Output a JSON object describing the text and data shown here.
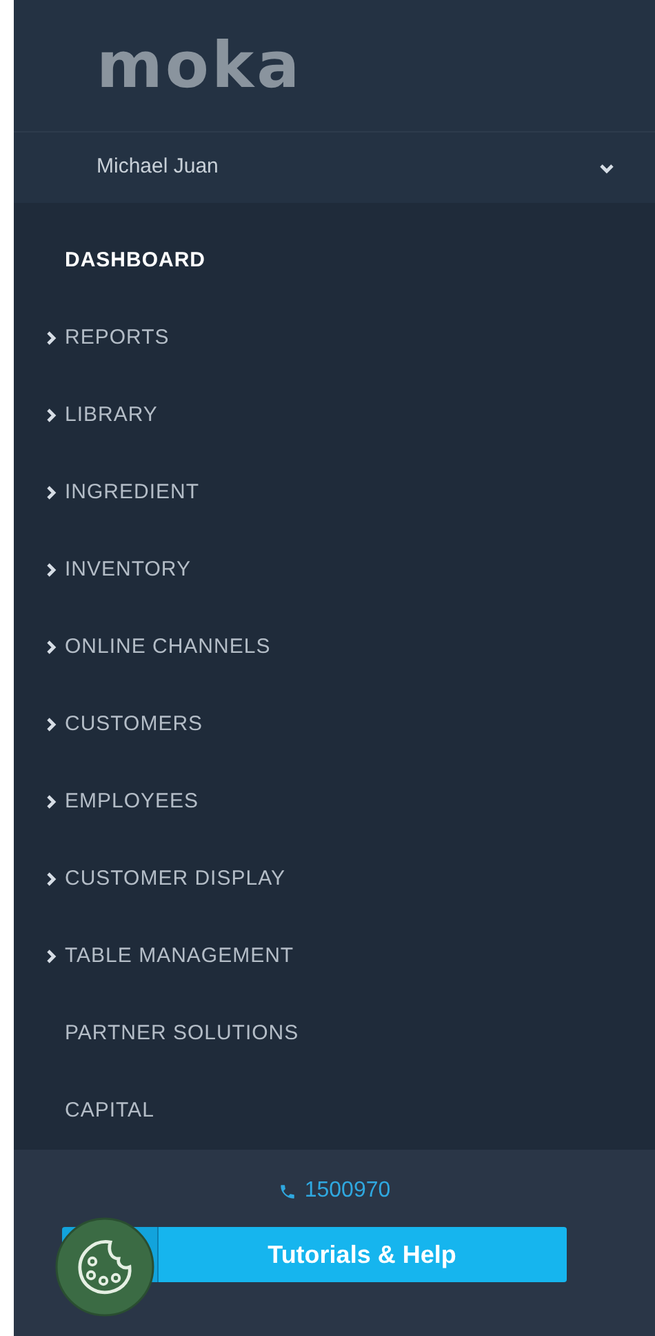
{
  "logo": {
    "text": "moka"
  },
  "user": {
    "name": "Michael Juan",
    "expanded": false
  },
  "menu": [
    {
      "label": "DASHBOARD",
      "selected": true,
      "has_children": false
    },
    {
      "label": "REPORTS",
      "selected": false,
      "has_children": true
    },
    {
      "label": "LIBRARY",
      "selected": false,
      "has_children": true
    },
    {
      "label": "INGREDIENT",
      "selected": false,
      "has_children": true
    },
    {
      "label": "INVENTORY",
      "selected": false,
      "has_children": true
    },
    {
      "label": "ONLINE CHANNELS",
      "selected": false,
      "has_children": true
    },
    {
      "label": "CUSTOMERS",
      "selected": false,
      "has_children": true
    },
    {
      "label": "EMPLOYEES",
      "selected": false,
      "has_children": true
    },
    {
      "label": "CUSTOMER DISPLAY",
      "selected": false,
      "has_children": true
    },
    {
      "label": "TABLE MANAGEMENT",
      "selected": false,
      "has_children": true
    },
    {
      "label": "PARTNER SOLUTIONS",
      "selected": false,
      "has_children": false
    },
    {
      "label": "CAPITAL",
      "selected": false,
      "has_children": false
    }
  ],
  "phone": "1500970",
  "help_button": {
    "label": "Tutorials & Help"
  }
}
